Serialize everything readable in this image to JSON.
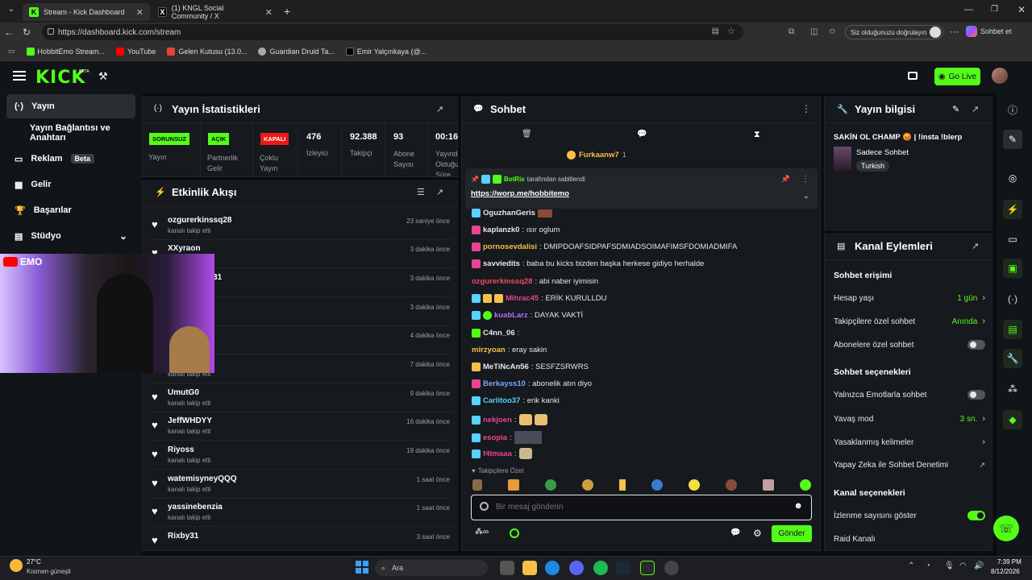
{
  "browser": {
    "tabs": [
      {
        "title": "Stream - Kick Dashboard",
        "active": true
      },
      {
        "title": "(1) KNGL Social Community / X",
        "active": false
      }
    ],
    "url": "https://dashboard.kick.com/stream",
    "incognito_text": "Siz olduğunuzu doğrulayın",
    "copilot_label": "Sohbet et",
    "bookmarks": [
      "HobbitEmo Stream...",
      "YouTube",
      "Gelen Kutusu (13.0...",
      "Guardian Druid Ta...",
      "Emir Yalçınkaya (@..."
    ]
  },
  "kick": {
    "logo": "KICK",
    "logo_badge": "BETA",
    "go_live": "Go Live"
  },
  "nav": {
    "items": [
      {
        "label": "Yayın",
        "active": true
      },
      {
        "label": "Yayın Bağlantısı ve Anahtarı"
      },
      {
        "label": "Reklam",
        "badge": "Beta"
      },
      {
        "label": "Gelir"
      },
      {
        "label": "Başarılar"
      },
      {
        "label": "Stüdyo"
      }
    ]
  },
  "webcam": {
    "label": "EMO"
  },
  "stats": {
    "title": "Yayın İstatistikleri",
    "cells": [
      {
        "tag": "SORUNSUZ",
        "tag_color": "#53fc18",
        "label": "Yayın"
      },
      {
        "tag": "AÇIK",
        "tag_color": "#53fc18",
        "label": "Partnerlik Gelir"
      },
      {
        "tag": "KAPALI",
        "tag_color": "#e91916",
        "label": "Çoklu Yayın"
      },
      {
        "value": "476",
        "label": "İzleyici"
      },
      {
        "value": "92.388",
        "label": "Takipçi"
      },
      {
        "value": "93",
        "label": "Abone Sayısı"
      },
      {
        "value": "00:16:",
        "label": "Yayında Olduğu Süre"
      }
    ]
  },
  "activity": {
    "title": "Etkinlik Akışı",
    "items": [
      {
        "name": "ozgurerkinssq28",
        "sub": "kanalı takip etti",
        "time": "23 saniye önce"
      },
      {
        "name": "XXyraon",
        "sub": "",
        "time": "3 dakika önce"
      },
      {
        "name": "h31",
        "sub": "",
        "time": "3 dakika önce"
      },
      {
        "name": "",
        "sub": "",
        "time": "3 dakika önce"
      },
      {
        "name": "",
        "sub": "",
        "time": "4 dakika önce"
      },
      {
        "name": "",
        "sub": "kanalı takip etti",
        "time": "7 dakika önce"
      },
      {
        "name": "UmutG0",
        "sub": "kanalı takip etti",
        "time": "9 dakika önce"
      },
      {
        "name": "JeffWHDYY",
        "sub": "kanalı takip etti",
        "time": "16 dakika önce"
      },
      {
        "name": "Riyoss",
        "sub": "kanalı takip etti",
        "time": "19 dakika önce"
      },
      {
        "name": "watemisyneyQQQ",
        "sub": "kanalı takip etti",
        "time": "1 saat önce"
      },
      {
        "name": "yassinebenzia",
        "sub": "kanalı takip etti",
        "time": "1 saat önce"
      },
      {
        "name": "Rixby31",
        "sub": "",
        "time": "3 saat önce"
      }
    ]
  },
  "chat": {
    "title": "Sohbet",
    "top_gifter": "Furkaanw7",
    "top_gifter_count": "1",
    "pinned_by": "BotRix",
    "pinned_suffix": "tarafından sabitlendi",
    "pinned_link": "https://worp.me/hobbitemo",
    "messages": [
      {
        "user": "OguzhanGeris",
        "color": "#e8e8e8",
        "text": ""
      },
      {
        "user": "kaplanzk0",
        "color": "#e8e8e8",
        "text": ": ısır oglum"
      },
      {
        "user": "pornosevdalisi",
        "color": "#f5c04a",
        "text": ": DMIPDOAFSIDPAFSDMIADSOIMAFIMSFDOMIADMIFA"
      },
      {
        "user": "savviedits",
        "color": "#e8e8e8",
        "text": ": baba bu kicks bizden başka herkese gidiyo herhalde"
      },
      {
        "user": "ozgurerkinssq28",
        "color": "#f14a6a",
        "text": ": abi naber iyimisin"
      },
      {
        "user": "Mihrac45",
        "color": "#e84393",
        "text": ": ERİK KURULLDU"
      },
      {
        "user": "kuabLarz",
        "color": "#b56bff",
        "text": ": DAYAK VAKTİ"
      },
      {
        "user": "C4nn_06",
        "color": "#e8e8e8",
        "text": ":"
      },
      {
        "user": "mirzyoan",
        "color": "#f5c04a",
        "text": ": eray sakin"
      },
      {
        "user": "MeTiNcAn56",
        "color": "#e8e8e8",
        "text": ": SESFZSRWRS"
      },
      {
        "user": "Berkayss10",
        "color": "#7aa7ff",
        "text": ": abonelik atın diyo"
      },
      {
        "user": "Carlitoo37",
        "color": "#5ad1ff",
        "text": ": erik kanki"
      },
      {
        "user": "nekjoen",
        "color": "#e84393",
        "text": ":"
      },
      {
        "user": "esopia",
        "color": "#f14a6a",
        "text": ":"
      },
      {
        "user": "f4tmaaa",
        "color": "#e84393",
        "text": ":"
      }
    ],
    "followers_only": "Takipçilere Özel",
    "input_placeholder": "Bir mesaj gönderin",
    "send_label": "Gönder"
  },
  "stream_info": {
    "title": "Yayın bilgisi",
    "stream_title": "SAKİN OL CHAMP 😡 | !insta !blerp",
    "category": "Sadece Sohbet",
    "tag": "Turkish"
  },
  "channel_actions": {
    "title": "Kanal Eylemleri",
    "sections": {
      "chat_access": "Sohbet erişimi",
      "chat_options": "Sohbet seçenekleri",
      "channel_options": "Kanal seçenekleri"
    },
    "rows": {
      "account_age": {
        "label": "Hesap yaşı",
        "value": "1 gün"
      },
      "followers_chat": {
        "label": "Takipçilere özel sohbet",
        "value": "Anında"
      },
      "subs_chat": {
        "label": "Abonelere özel sohbet"
      },
      "emote_only": {
        "label": "Yalnızca Emotlarla sohbet"
      },
      "slow_mode": {
        "label": "Yavaş mod",
        "value": "3 sn."
      },
      "banned_words": {
        "label": "Yasaklanmış kelimeler"
      },
      "ai_moderation": {
        "label": "Yapay Zeka ile Sohbet Denetimi"
      },
      "show_viewers": {
        "label": "İzlenme sayısını göster"
      },
      "raid": {
        "label": "Raid Kanalı"
      }
    }
  },
  "taskbar": {
    "weather_temp": "27°C",
    "weather_desc": "Kısmen güneşli",
    "search_placeholder": "Ara",
    "time": "7:39 PM",
    "date": "8/12/2026"
  }
}
